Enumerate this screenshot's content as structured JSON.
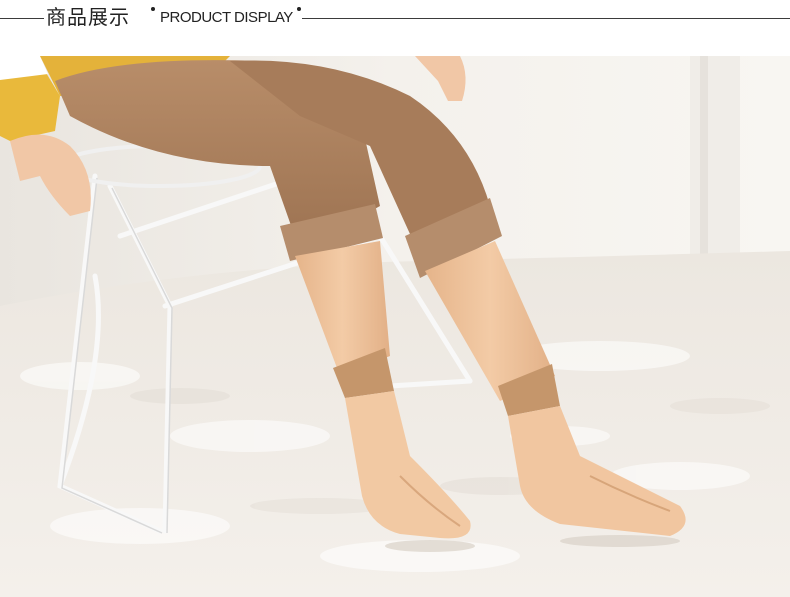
{
  "header": {
    "title_cn": "商品展示",
    "title_en": "PRODUCT DISPLAY"
  },
  "photo": {
    "subject": "product-photo",
    "colors": {
      "background": "#f1ede6",
      "rug": "#f3efea",
      "trousers": "#a97f5d",
      "sock": "#f2c9a3",
      "sock_cuff": "#c2956a",
      "sweater": "#e8b83c",
      "chair": "#f7f7f7"
    }
  }
}
